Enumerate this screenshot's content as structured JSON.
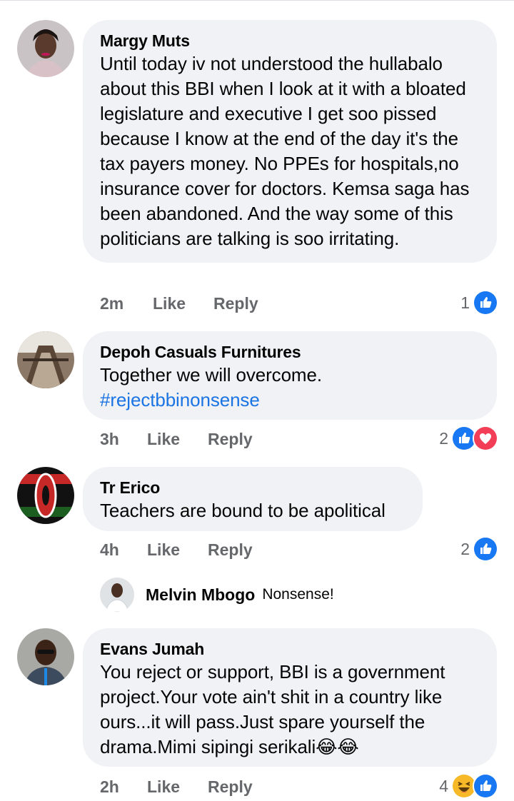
{
  "comments": [
    {
      "author": "Margy Muts",
      "text": "Until today iv not understood the hullabalo about this BBI when I look at it with a bloated legislature and executive I get soo pissed because I know at the end of the day it's the tax payers money. No PPEs for hospitals,no insurance cover for doctors. Kemsa saga has been abandoned. And the way some of this politicians are talking is soo irritating.",
      "time": "2m",
      "like": "Like",
      "reply": "Reply",
      "reaction_count": "1",
      "reactions": [
        "like-icon"
      ]
    },
    {
      "author": "Depoh Casuals Furnitures",
      "text": "Together we will overcome.",
      "hashtag": "#rejectbbinonsense",
      "time": "3h",
      "like": "Like",
      "reply": "Reply",
      "reaction_count": "2",
      "reactions": [
        "like-icon",
        "love-icon"
      ]
    },
    {
      "author": "Tr Erico",
      "text": "Teachers are bound to be apolitical",
      "time": "4h",
      "like": "Like",
      "reply": "Reply",
      "reaction_count": "2",
      "reactions": [
        "like-icon"
      ],
      "reply_preview": {
        "author": "Melvin Mbogo",
        "text": "Nonsense!"
      }
    },
    {
      "author": "Evans Jumah",
      "text": "You reject or support, BBI is a government project.Your vote ain't shit in a country like ours...it will pass.Just spare yourself the drama.Mimi sipingi serikali",
      "emoji": "😂😂",
      "time": "2h",
      "like": "Like",
      "reply": "Reply",
      "reaction_count": "4",
      "reactions": [
        "haha-icon",
        "like-icon"
      ]
    }
  ],
  "colors": {
    "bubble": "#f0f2f5",
    "meta": "#65676b",
    "link": "#1b74e4",
    "like_blue": "#1877f2",
    "love_red": "#f33e58",
    "haha_yellow": "#f7b928"
  }
}
